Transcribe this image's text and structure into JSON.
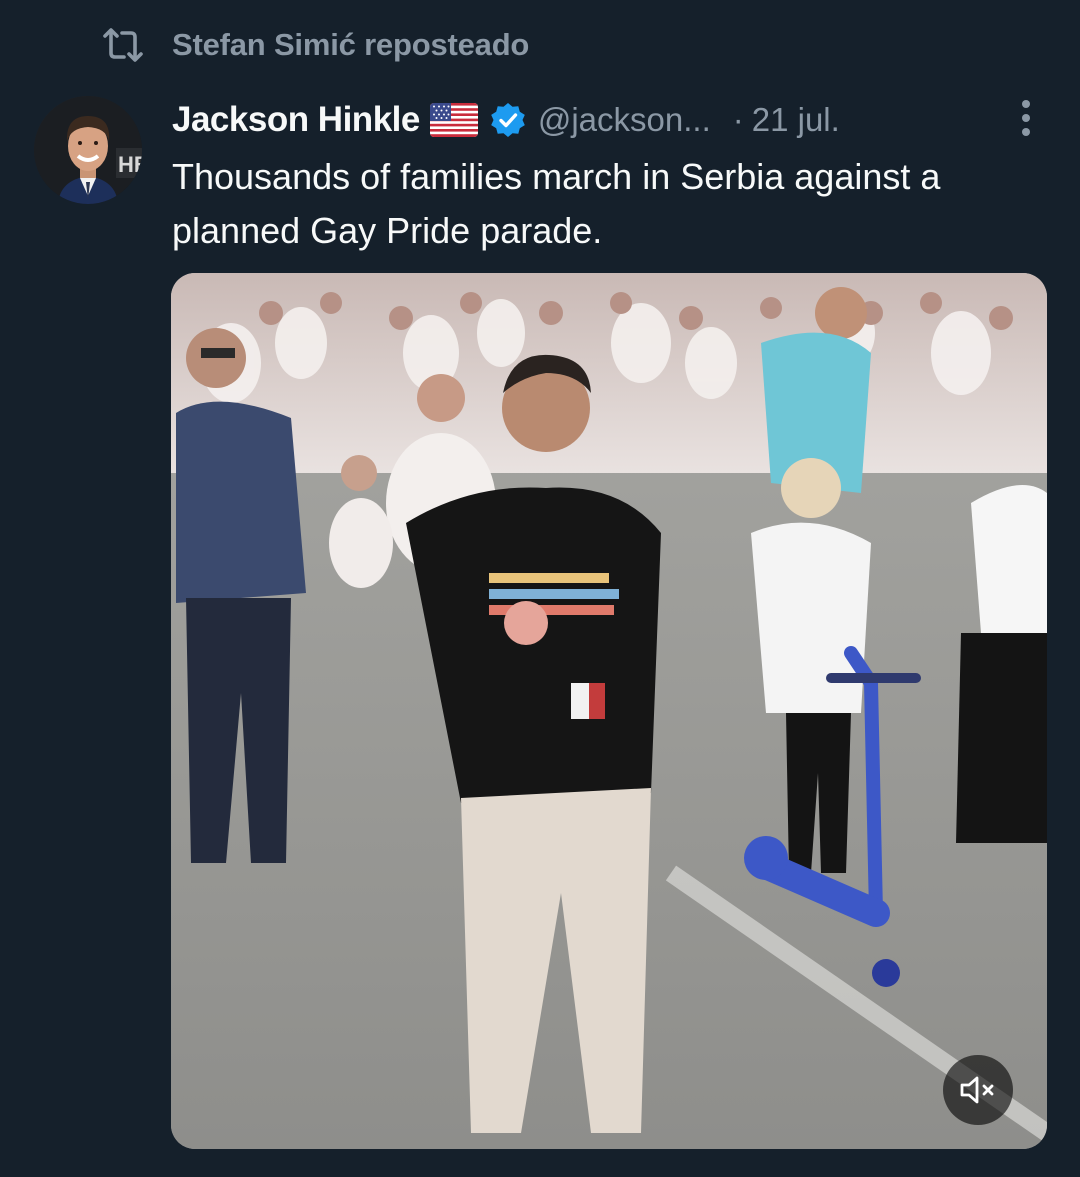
{
  "repost": {
    "text": "Stefan Simić reposteado",
    "icon": "repost-icon"
  },
  "tweet": {
    "author_name": "Jackson Hinkle",
    "flag": "🇺🇸",
    "handle": "@jackson...",
    "separator": "·",
    "date": "21 jul.",
    "text": "Thousands of families march in Serbia against a planned Gay Pride parade.",
    "avatar_badge": "HB",
    "verified_icon": "verified-badge-icon",
    "more_icon": "more-options-icon"
  },
  "media": {
    "type": "video",
    "mute_icon": "volume-muted-icon"
  },
  "colors": {
    "background": "#15202b",
    "primary_text": "#f7f9f9",
    "secondary_text": "#8b98a5",
    "verified_blue": "#1d9bf0"
  }
}
